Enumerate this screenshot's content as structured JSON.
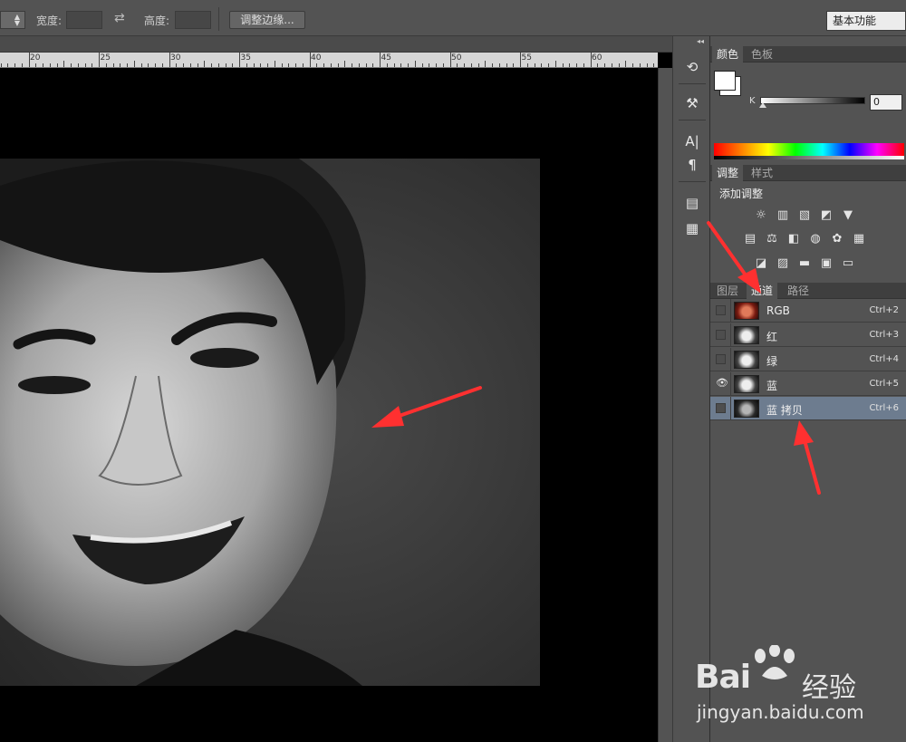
{
  "options_bar": {
    "width_label": "宽度:",
    "height_label": "高度:",
    "refine_edge_button": "调整边缘...",
    "workspace": "基本功能"
  },
  "ruler": {
    "numbers": [
      "20",
      "25",
      "30",
      "35",
      "40",
      "45",
      "50",
      "55",
      "60"
    ]
  },
  "color_panel": {
    "tabs": [
      "颜色",
      "色板"
    ],
    "slider_label": "K",
    "slider_value": "0",
    "slider_level": 0
  },
  "adjustments_panel": {
    "tabs": [
      "调整",
      "样式"
    ],
    "title": "添加调整",
    "icons_row1": [
      "brightness-contrast-icon",
      "levels-icon",
      "curves-icon",
      "exposure-icon",
      "vibrance-icon"
    ],
    "icons_row2": [
      "hue-saturation-icon",
      "color-balance-icon",
      "black-white-icon",
      "photo-filter-icon",
      "channel-mixer-icon",
      "color-lookup-icon"
    ],
    "icons_row3": [
      "invert-icon",
      "posterize-icon",
      "threshold-icon",
      "selective-color-icon",
      "gradient-map-icon"
    ]
  },
  "layers_panel": {
    "tabs": [
      "图层",
      "通道",
      "路径"
    ],
    "active_tab": "通道",
    "channels": [
      {
        "name": "RGB",
        "shortcut": "Ctrl+2",
        "visible": false,
        "selected": false,
        "thumb": "color"
      },
      {
        "name": "红",
        "shortcut": "Ctrl+3",
        "visible": false,
        "selected": false,
        "thumb": "gray"
      },
      {
        "name": "绿",
        "shortcut": "Ctrl+4",
        "visible": false,
        "selected": false,
        "thumb": "gray"
      },
      {
        "name": "蓝",
        "shortcut": "Ctrl+5",
        "visible": true,
        "selected": false,
        "thumb": "gray"
      },
      {
        "name": "蓝 拷贝",
        "shortcut": "Ctrl+6",
        "visible": false,
        "selected": true,
        "thumb": "dark"
      }
    ]
  },
  "watermark": {
    "brand": "Bai",
    "brand2": "经验",
    "url": "jingyan.baidu.com"
  },
  "colors": {
    "accent_arrow": "#ff3030",
    "selected_row": "#6d7c8f"
  }
}
